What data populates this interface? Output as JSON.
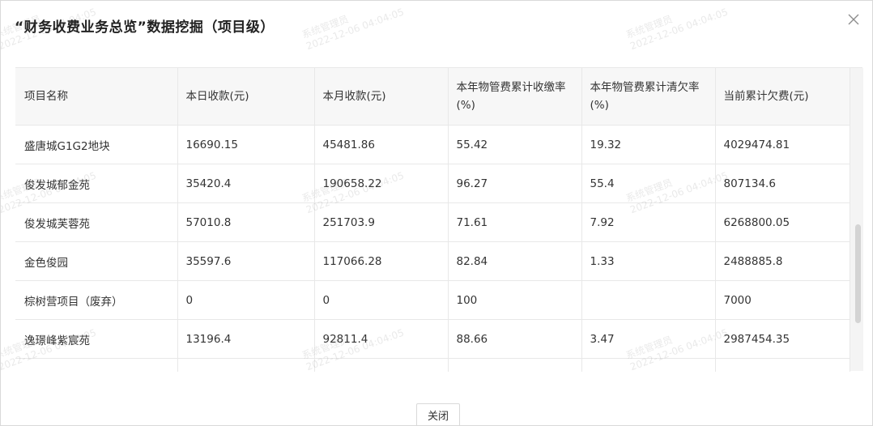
{
  "dialog": {
    "title": "“财务收费业务总览”数据挖掘（项目级）",
    "close_button_label": "关闭"
  },
  "watermark": {
    "name": "系统管理员",
    "timestamp": "2022-12-06 04:04:05"
  },
  "table": {
    "columns": [
      "项目名称",
      "本日收款(元)",
      "本月收款(元)",
      "本年物管费累计收缴率(%)",
      "本年物管费累计清欠率(%)",
      "当前累计欠费(元)"
    ],
    "rows": [
      [
        "盛唐城G1G2地块",
        "16690.15",
        "45481.86",
        "55.42",
        "19.32",
        "4029474.81"
      ],
      [
        "俊发城郁金苑",
        "35420.4",
        "190658.22",
        "96.27",
        "55.4",
        "807134.6"
      ],
      [
        "俊发城芙蓉苑",
        "57010.8",
        "251703.9",
        "71.61",
        "7.92",
        "6268800.05"
      ],
      [
        "金色俊园",
        "35597.6",
        "117066.28",
        "82.84",
        "1.33",
        "2488885.8"
      ],
      [
        "棕树营项目（废弃）",
        "0",
        "0",
        "100",
        "",
        "7000"
      ],
      [
        "逸璟峰紫宸苑",
        "13196.4",
        "92811.4",
        "88.66",
        "3.47",
        "2987454.35"
      ],
      [
        "",
        "",
        "",
        "",
        "",
        ""
      ]
    ]
  },
  "colors": {
    "header_bg": "#f7f7f7",
    "border": "#e8e8e8",
    "text": "#333333"
  }
}
